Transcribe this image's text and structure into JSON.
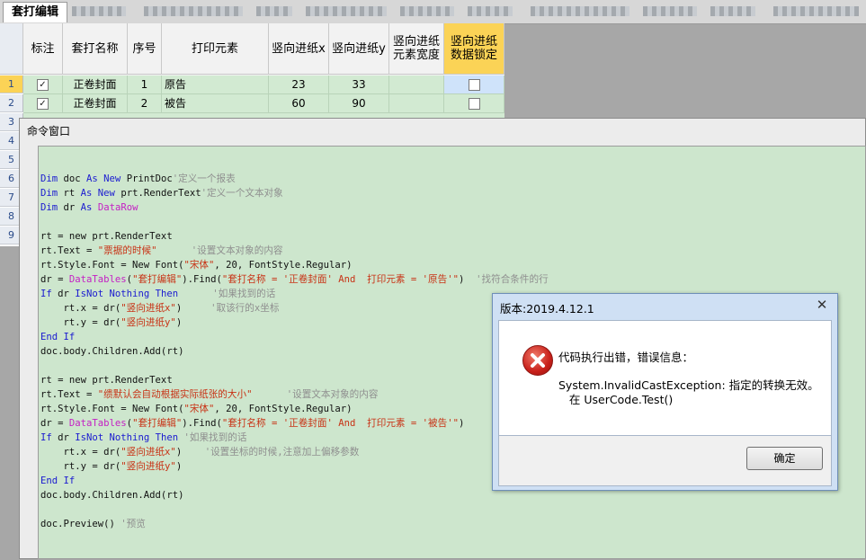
{
  "tabs": {
    "active_label": "套打编辑"
  },
  "grid": {
    "columns": [
      "标注",
      "套打名称",
      "序号",
      "打印元素",
      "竖向进纸x",
      "竖向进纸y",
      "竖向进纸\n元素宽度",
      "竖向进纸\n数据锁定"
    ],
    "row_numbers": [
      "1",
      "2",
      "3",
      "4",
      "5",
      "6",
      "7",
      "8",
      "9"
    ],
    "rows": [
      {
        "checked": "✓",
        "name": "正卷封面",
        "seq": "1",
        "element": "原告",
        "x": "23",
        "y": "33"
      },
      {
        "checked": "✓",
        "name": "正卷封面",
        "seq": "2",
        "element": "被告",
        "x": "60",
        "y": "90"
      }
    ]
  },
  "command_window": {
    "title": "命令窗口"
  },
  "dialog": {
    "title": "版本:2019.4.12.1",
    "close": "✕",
    "heading": "代码执行出错，错误信息：",
    "message_line1": "System.InvalidCastException: 指定的转换无效。",
    "message_line2": "   在 UserCode.Test()",
    "ok_label": "确定",
    "icon": "error-x-icon"
  },
  "colors": {
    "grid_row": "#d2ead2",
    "header_gold": "#fbd356",
    "code_bg": "#cde6cd",
    "keyword": "#1b1bd0",
    "string": "#c83215",
    "comment": "#8f8f8f",
    "type": "#c41fc4"
  }
}
